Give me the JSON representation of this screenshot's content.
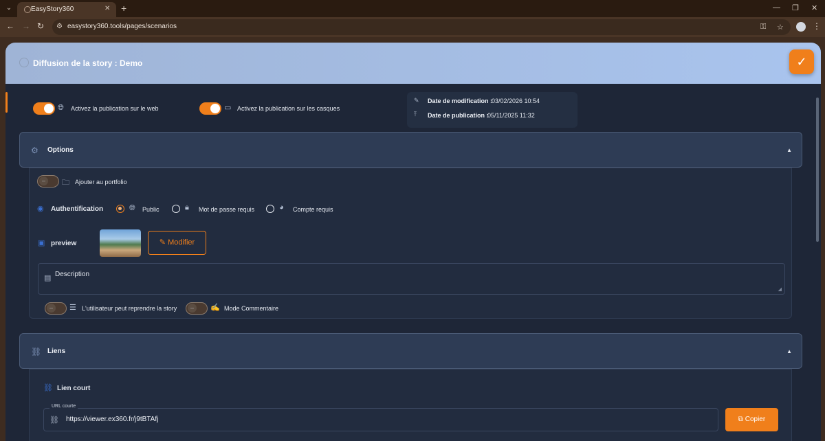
{
  "browser": {
    "tab_title": "EasyStory360",
    "url": "easystory360.tools/pages/scenarios"
  },
  "modal": {
    "title": "Diffusion de la story : Demo",
    "confirm_icon": "check-icon"
  },
  "publishing": {
    "web_label": "Activez la publication sur le web",
    "web_enabled": true,
    "headset_label": "Activez la publication sur les casques",
    "headset_enabled": true
  },
  "meta": {
    "modified_label": "Date de modification :",
    "modified_value": "03/02/2026 10:54",
    "published_label": "Date de publication :",
    "published_value": "05/11/2025 11:32"
  },
  "options": {
    "title": "Options",
    "portfolio_label": "Ajouter au portfolio",
    "portfolio_enabled": false,
    "auth_label": "Authentification",
    "auth_options": [
      "Public",
      "Mot de passe requis",
      "Compte requis"
    ],
    "auth_selected": "Public",
    "preview_label": "preview",
    "modify_button": "Modifier",
    "description_placeholder": "Description",
    "resume_label": "L'utilisateur peut reprendre la story",
    "resume_enabled": false,
    "comment_label": "Mode Commentaire",
    "comment_enabled": false
  },
  "links": {
    "title": "Liens",
    "short_link_title": "Lien court",
    "url_label": "URL courte",
    "url_value": "https://viewer.ex360.fr/j9tBTAfj",
    "copy_button": "Copier"
  },
  "colors": {
    "accent": "#f07f1b",
    "header": "#a9c4ee",
    "background": "#1e2637"
  }
}
